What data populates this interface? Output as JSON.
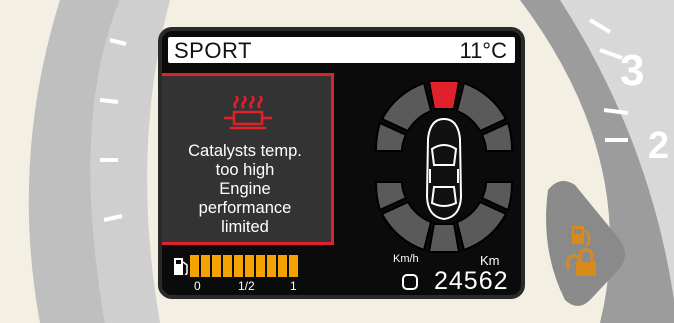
{
  "display": {
    "mode": "SPORT",
    "outside_temp": "11°C"
  },
  "warning": {
    "icon": "catalyst-temperature-icon",
    "lines": [
      "Catalysts temp.",
      "too high",
      "Engine",
      "performance",
      "limited"
    ]
  },
  "tires": {
    "highlighted": "front-center",
    "icon": "car-top-view-icon"
  },
  "fuel": {
    "icon": "fuel-pump-icon",
    "level_fraction": 1.0,
    "scale_labels": [
      "0",
      "1/2",
      "1"
    ]
  },
  "odometer": {
    "speed_unit": "Km/h",
    "distance_unit": "Km",
    "value": "24562"
  },
  "side_indicators": [
    "fuel-pump-icon",
    "lock-icon"
  ],
  "colors": {
    "warning_red": "#e0202a",
    "fuel_orange": "#f5a300",
    "indicator_amber": "#d98a1c"
  }
}
